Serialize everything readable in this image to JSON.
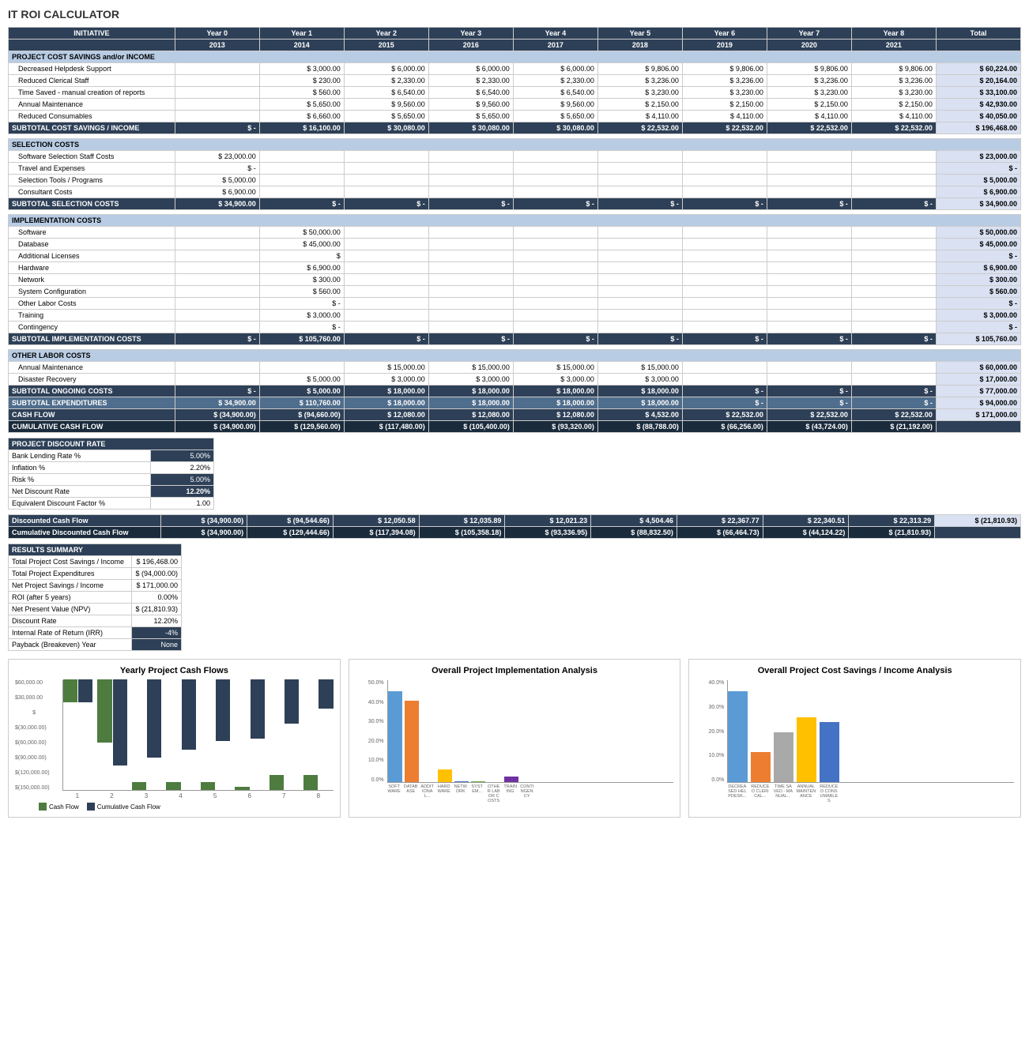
{
  "title": "IT ROI CALCULATOR",
  "columns": {
    "initiative": "INITIATIVE",
    "year0": "Year 0",
    "year1": "Year 1",
    "year2": "Year 2",
    "year3": "Year 3",
    "year4": "Year 4",
    "year5": "Year 5",
    "year6": "Year 6",
    "year7": "Year 7",
    "year8": "Year 8",
    "total": "Total"
  },
  "years": {
    "y0": "2013",
    "y1": "2014",
    "y2": "2015",
    "y3": "2016",
    "y4": "2017",
    "y5": "2018",
    "y6": "2019",
    "y7": "2020",
    "y8": "2021"
  },
  "sections": {
    "savings_header": "PROJECT COST SAVINGS and/or INCOME",
    "selection_header": "SELECTION COSTS",
    "implementation_header": "IMPLEMENTATION COSTS",
    "other_labor_header": "OTHER LABOR COSTS",
    "discount_header": "PROJECT DISCOUNT RATE",
    "results_header": "RESULTS SUMMARY"
  },
  "savings_items": [
    {
      "label": "Decreased Helpdesk Support",
      "y0": "",
      "y1": "3,000.00",
      "y2": "6,000.00",
      "y3": "6,000.00",
      "y4": "6,000.00",
      "y5": "9,806.00",
      "y6": "9,806.00",
      "y7": "9,806.00",
      "y8": "9,806.00",
      "total": "60,224.00"
    },
    {
      "label": "Reduced Clerical Staff",
      "y0": "",
      "y1": "230.00",
      "y2": "2,330.00",
      "y3": "2,330.00",
      "y4": "2,330.00",
      "y5": "3,236.00",
      "y6": "3,236.00",
      "y7": "3,236.00",
      "y8": "3,236.00",
      "total": "20,164.00"
    },
    {
      "label": "Time Saved - manual creation of reports",
      "y0": "",
      "y1": "560.00",
      "y2": "6,540.00",
      "y3": "6,540.00",
      "y4": "6,540.00",
      "y5": "3,230.00",
      "y6": "3,230.00",
      "y7": "3,230.00",
      "y8": "3,230.00",
      "total": "33,100.00"
    },
    {
      "label": "Annual Maintenance",
      "y0": "",
      "y1": "5,650.00",
      "y2": "9,560.00",
      "y3": "9,560.00",
      "y4": "9,560.00",
      "y5": "2,150.00",
      "y6": "2,150.00",
      "y7": "2,150.00",
      "y8": "2,150.00",
      "total": "42,930.00"
    },
    {
      "label": "Reduced Consumables",
      "y0": "",
      "y1": "6,660.00",
      "y2": "5,650.00",
      "y3": "5,650.00",
      "y4": "5,650.00",
      "y5": "4,110.00",
      "y6": "4,110.00",
      "y7": "4,110.00",
      "y8": "4,110.00",
      "total": "40,050.00"
    }
  ],
  "savings_subtotal": {
    "label": "SUBTOTAL COST SAVINGS / INCOME",
    "y0": "$ -",
    "y1": "$ 16,100.00",
    "y2": "$ 30,080.00",
    "y3": "$ 30,080.00",
    "y4": "$ 30,080.00",
    "y5": "$ 22,532.00",
    "y6": "$ 22,532.00",
    "y7": "$ 22,532.00",
    "y8": "$ 22,532.00",
    "total": "$ 196,468.00"
  },
  "selection_items": [
    {
      "label": "Software Selection Staff Costs",
      "y0": "23,000.00",
      "total": "23,000.00"
    },
    {
      "label": "Travel and Expenses",
      "y0": "-",
      "total": "-"
    },
    {
      "label": "Selection Tools / Programs",
      "y0": "5,000.00",
      "total": "5,000.00"
    },
    {
      "label": "Consultant Costs",
      "y0": "6,900.00",
      "total": "6,900.00"
    }
  ],
  "selection_subtotal": {
    "label": "SUBTOTAL SELECTION COSTS",
    "y0": "$ 34,900.00",
    "y1": "$ -",
    "y2": "$ -",
    "y3": "$ -",
    "y4": "$ -",
    "y5": "$ -",
    "y6": "$ -",
    "y7": "$ -",
    "y8": "$ -",
    "total": "$ 34,900.00"
  },
  "impl_items": [
    {
      "label": "Software",
      "y1": "50,000.00",
      "total": "50,000.00"
    },
    {
      "label": "Database",
      "y1": "45,000.00",
      "total": "45,000.00"
    },
    {
      "label": "Additional Licenses",
      "y1": "",
      "total": "-"
    },
    {
      "label": "Hardware",
      "y1": "6,900.00",
      "total": "6,900.00"
    },
    {
      "label": "Network",
      "y1": "300.00",
      "total": "300.00"
    },
    {
      "label": "System Configuration",
      "y1": "560.00",
      "total": "560.00"
    },
    {
      "label": "Other Labor Costs",
      "y1": "-",
      "total": "-"
    },
    {
      "label": "Training",
      "y1": "3,000.00",
      "total": "3,000.00"
    },
    {
      "label": "Contingency",
      "y1": "-",
      "total": "-"
    }
  ],
  "impl_subtotal": {
    "label": "SUBTOTAL IMPLEMENTATION COSTS",
    "y0": "$ -",
    "y1": "$ 105,760.00",
    "y2": "$ -",
    "y3": "$ -",
    "y4": "$ -",
    "y5": "$ -",
    "y6": "$ -",
    "y7": "$ -",
    "y8": "$ -",
    "total": "$ 105,760.00"
  },
  "labor_items": [
    {
      "label": "Annual Maintenance",
      "y2": "15,000.00",
      "y3": "15,000.00",
      "y4": "15,000.00",
      "y5": "15,000.00",
      "total": "60,000.00"
    },
    {
      "label": "Disaster Recovery",
      "y1": "5,000.00",
      "y2": "3,000.00",
      "y3": "3,000.00",
      "y4": "3,000.00",
      "y5": "3,000.00",
      "total": "17,000.00"
    }
  ],
  "labor_subtotal": {
    "label": "SUBTOTAL ONGOING COSTS",
    "y0": "$ -",
    "y1": "$ 5,000.00",
    "y2": "$ 18,000.00",
    "y3": "$ 18,000.00",
    "y4": "$ 18,000.00",
    "y5": "$ 18,000.00",
    "y6": "$ -",
    "y7": "$ -",
    "y8": "$ -",
    "total": "$ 77,000.00"
  },
  "subtotal_exp": {
    "label": "SUBTOTAL EXPENDITURES",
    "y0": "$ 34,900.00",
    "y1": "$ 110,760.00",
    "y2": "$ 18,000.00",
    "y3": "$ 18,000.00",
    "y4": "$ 18,000.00",
    "y5": "$ 18,000.00",
    "y6": "$ -",
    "y7": "$ -",
    "y8": "$ -",
    "total": "$ 94,000.00"
  },
  "cashflow": {
    "label": "CASH FLOW",
    "y0": "$ (34,900.00)",
    "y1": "$ (94,660.00)",
    "y2": "$ 12,080.00",
    "y3": "$ 12,080.00",
    "y4": "$ 12,080.00",
    "y5": "$ 4,532.00",
    "y6": "$ 22,532.00",
    "y7": "$ 22,532.00",
    "y8": "$ 22,532.00",
    "total": "$ 171,000.00"
  },
  "cumcashflow": {
    "label": "CUMULATIVE CASH FLOW",
    "y0": "$ (34,900.00)",
    "y1": "$ (129,560.00)",
    "y2": "$ (117,480.00)",
    "y3": "$ (105,400.00)",
    "y4": "$ (93,320.00)",
    "y5": "$ (88,788.00)",
    "y6": "$ (66,256.00)",
    "y7": "$ (43,724.00)",
    "y8": "$ (21,192.00)"
  },
  "discount": {
    "bank_rate_label": "Bank Lending Rate %",
    "bank_rate_val": "5.00%",
    "inflation_label": "Inflation %",
    "inflation_val": "2.20%",
    "risk_label": "Risk %",
    "risk_val": "5.00%",
    "net_discount_label": "Net Discount Rate",
    "net_discount_val": "12.20%",
    "equiv_factor_label": "Equivalent Discount Factor %",
    "equiv_factor_val": "1.00",
    "disc_cashflow_label": "Discounted Cash Flow",
    "disc_cashflow": {
      "y0": "$ (34,900.00)",
      "y1": "$ (94,544.66)",
      "y2": "$ 12,050.58",
      "y3": "$ 12,035.89",
      "y4": "$ 12,021.23",
      "y5": "$ 4,504.46",
      "y6": "$ 22,367.77",
      "y7": "$ 22,340.51",
      "y8": "$ 22,313.29",
      "total": "$ (21,810.93)"
    },
    "cum_disc_label": "Cumulative Discounted Cash Flow",
    "cum_disc": {
      "y0": "$ (34,900.00)",
      "y1": "$ (129,444.66)",
      "y2": "$ (117,394.08)",
      "y3": "$ (105,358.18)",
      "y4": "$ (93,336.95)",
      "y5": "$ (88,832.50)",
      "y6": "$ (66,464.73)",
      "y7": "$ (44,124.22)",
      "y8": "$ (21,810.93)"
    }
  },
  "results": {
    "total_savings_label": "Total Project Cost Savings / Income",
    "total_savings_val": "$ 196,468.00",
    "total_exp_label": "Total Project Expenditures",
    "total_exp_val": "$ (94,000.00)",
    "net_savings_label": "Net Project Savings / Income",
    "net_savings_val": "$ 171,000.00",
    "roi_label": "ROI (after 5 years)",
    "roi_val": "0.00%",
    "npv_label": "Net Present Value (NPV)",
    "npv_val": "$ (21,810.93)",
    "discount_label": "Discount Rate",
    "discount_val": "12.20%",
    "irr_label": "Internal Rate of Return (IRR)",
    "irr_val": "-4%",
    "payback_label": "Payback (Breakeven) Year",
    "payback_val": "None"
  },
  "charts": {
    "cashflow_title": "Yearly Project Cash Flows",
    "impl_title": "Overall Project Implementation Analysis",
    "savings_title": "Overall Project Cost Savings / Income Analysis",
    "cashflow_data": [
      {
        "year": "1",
        "cashflow": -34900,
        "cumulative": -34900
      },
      {
        "year": "2",
        "cashflow": -94660,
        "cumulative": -129560
      },
      {
        "year": "3",
        "cashflow": 12080,
        "cumulative": -117480
      },
      {
        "year": "4",
        "cashflow": 12080,
        "cumulative": -105400
      },
      {
        "year": "5",
        "cashflow": 12080,
        "cumulative": -93320
      },
      {
        "year": "6",
        "cashflow": 4532,
        "cumulative": -88788
      },
      {
        "year": "7",
        "cashflow": 22532,
        "cumulative": -66256
      },
      {
        "year": "8",
        "cashflow": 22532,
        "cumulative": -43724
      }
    ],
    "impl_labels": [
      "SOFTWARE",
      "DATABASE",
      "ADDITIONAL...",
      "HARDWARE",
      "NETWORK",
      "SYSTEM...",
      "OTHER LABOR COSTS",
      "TRAINING",
      "CONTINGENCY"
    ],
    "impl_values": [
      50000,
      45000,
      0,
      6900,
      300,
      560,
      0,
      3000,
      0
    ],
    "savings_labels": [
      "DECREASED HELPDESK...",
      "REDUCED CLERICAL...",
      "TIME SAVED - MANUAL...",
      "ANNUAL MAINTENANCE",
      "REDUCED CONSUMABLES"
    ],
    "savings_values": [
      60224,
      20164,
      33100,
      42930,
      40050
    ],
    "legend_cashflow": "Cash Flow",
    "legend_cumulative": "Cumulative Cash Flow"
  }
}
